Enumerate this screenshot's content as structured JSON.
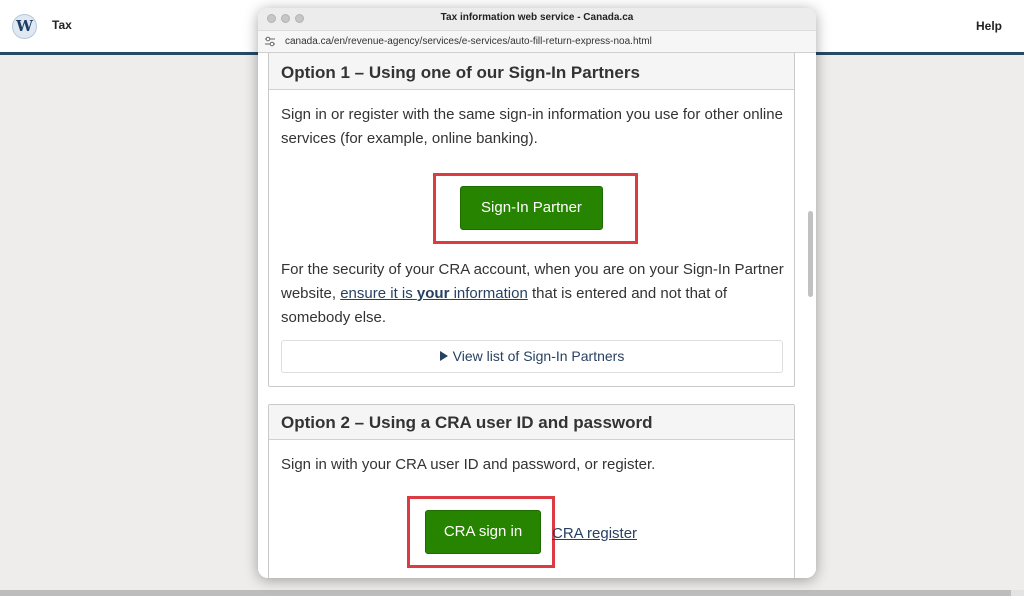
{
  "app": {
    "logo_letter": "W",
    "title": "Tax",
    "help": "Help"
  },
  "window": {
    "title": "Tax information web service - Canada.ca",
    "url": "canada.ca/en/revenue-agency/services/e-services/auto-fill-return-express-noa.html"
  },
  "option1": {
    "title": "Option 1 – Using one of our Sign-In Partners",
    "description": "Sign in or register with the same sign-in information you use for other online services (for example, online banking).",
    "button_label": "Sign-In Partner",
    "security_before": "For the security of your CRA account, when you are on your Sign-In Partner website, ",
    "security_link_a": "ensure it is ",
    "security_link_bold": "your",
    "security_link_b": " information",
    "security_after": " that is entered and not that of somebody else.",
    "details_label": "View list of Sign-In Partners"
  },
  "option2": {
    "title": "Option 2 – Using a CRA user ID and password",
    "description": "Sign in with your CRA user ID and password, or register.",
    "signin_label": "CRA sign in",
    "register_label": "CRA register"
  },
  "colors": {
    "button_green": "#278400",
    "highlight_red": "#dd3b44",
    "link_blue": "#284162",
    "header_rule": "#284a64"
  },
  "icons": {
    "url_site": "site-settings-icon",
    "details_toggle": "triangle-right-icon"
  }
}
